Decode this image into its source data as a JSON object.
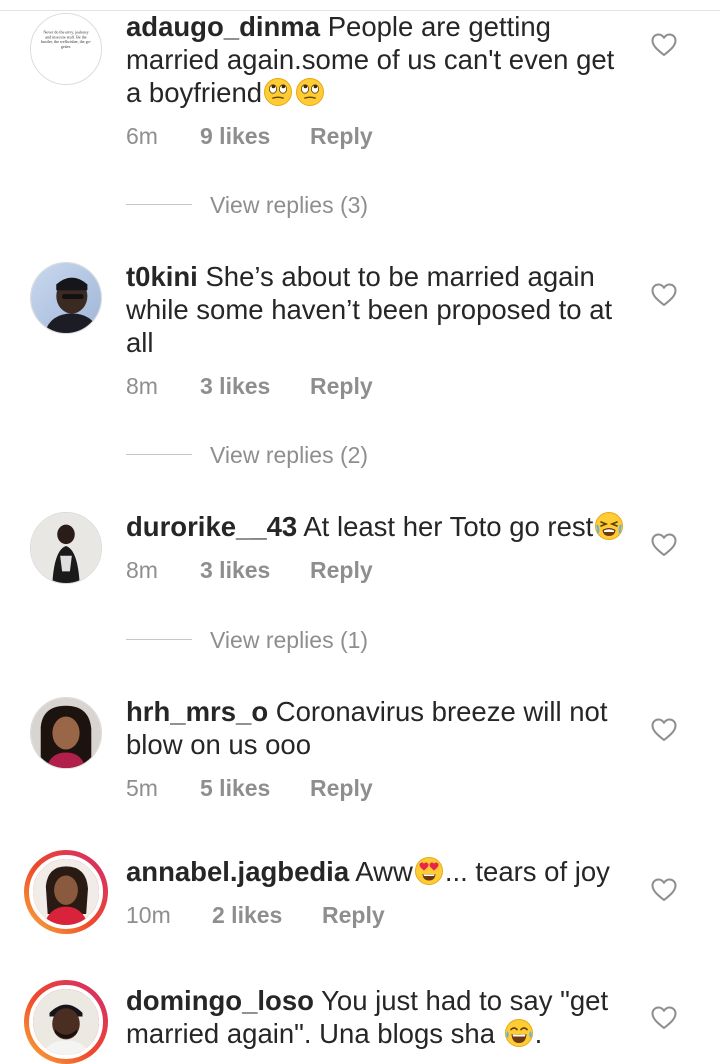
{
  "comments": [
    {
      "username": "adaugo_dinma",
      "text": "People are getting married again.some of us can't even get a boyfriend",
      "emoji": [
        "face-with-rolling-eyes",
        "face-with-rolling-eyes"
      ],
      "time": "6m",
      "likes": "9 likes",
      "reply": "Reply",
      "view_replies": "View replies (3)",
      "avatar_text": "Never do the envy, jealousy and insecure stuff. Be the hustler, the wellwisher, the go-getter."
    },
    {
      "username": "t0kini",
      "text": "She’s about to be married again while some haven’t been proposed to at all",
      "time": "8m",
      "likes": "3 likes",
      "reply": "Reply",
      "view_replies": "View replies (2)"
    },
    {
      "username": "durorike__43",
      "text": "At least her Toto go rest",
      "emoji": [
        "tired-face"
      ],
      "time": "8m",
      "likes": "3 likes",
      "reply": "Reply",
      "view_replies": "View replies (1)"
    },
    {
      "username": "hrh_mrs_o",
      "text": "Coronavirus breeze will not blow on us ooo",
      "time": "5m",
      "likes": "5 likes",
      "reply": "Reply"
    },
    {
      "username": "annabel.jagbedia",
      "text_before": "Aww",
      "emoji": [
        "smiling-face-with-heart-eyes"
      ],
      "text_after": "... tears of joy",
      "time": "10m",
      "likes": "2 likes",
      "reply": "Reply"
    },
    {
      "username": "domingo_loso",
      "text": "You just had to say \"get married again\". Una blogs sha",
      "emoji": [
        "face-with-tears-of-joy"
      ],
      "text_after": ".",
      "time": "",
      "likes": "",
      "reply": ""
    }
  ],
  "icons": {
    "like": "heart-outline-icon",
    "story_ring_colors": [
      "#f9b03a",
      "#ee4b2b",
      "#d2296f"
    ]
  },
  "colors": {
    "text": "#262626",
    "secondary": "#8e8e8e"
  }
}
